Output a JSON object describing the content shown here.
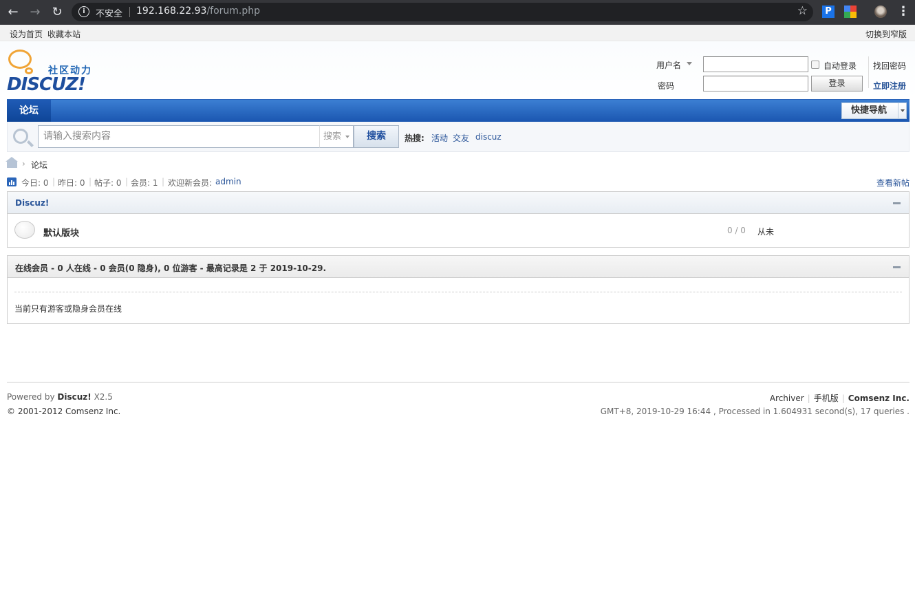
{
  "browser": {
    "security_label": "不安全",
    "url_host": "192.168.22.93",
    "url_path": "/forum.php",
    "ext_p_label": "P"
  },
  "topbar": {
    "set_homepage": "设为首页",
    "bookmark": "收藏本站",
    "switch_narrow": "切换到窄版"
  },
  "logo": {
    "tagline": "社区动力",
    "wordmark": "DISCUZ!"
  },
  "login": {
    "username_label": "用户名",
    "password_label": "密码",
    "auto_login": "自动登录",
    "login_button": "登录",
    "forgot_password": "找回密码",
    "register": "立即注册"
  },
  "nav": {
    "forum_tab": "论坛",
    "quick_nav": "快捷导航"
  },
  "search": {
    "placeholder": "请输入搜索内容",
    "scope": "搜索",
    "button": "搜索",
    "hot_label": "热搜:",
    "hot_items": [
      "活动",
      "交友",
      "discuz"
    ]
  },
  "breadcrumb": {
    "separator": "›",
    "current": "论坛"
  },
  "stats": {
    "today": "今日: 0",
    "yesterday": "昨日: 0",
    "posts": "帖子: 0",
    "members": "会员: 1",
    "welcome_label": "欢迎新会员:",
    "newest_member": "admin",
    "view_new_posts": "查看新帖"
  },
  "category": {
    "title": "Discuz!",
    "forums": [
      {
        "name": "默认版块",
        "counts": "0 / 0",
        "last_post": "从未"
      }
    ]
  },
  "online": {
    "title": "在线会员 - 0 人在线 - 0 会员(0 隐身), 0 位游客 - 最高记录是 2 于 2019-10-29.",
    "message": "当前只有游客或隐身会员在线"
  },
  "footer": {
    "powered_by": "Powered by",
    "product": "Discuz!",
    "version": "X2.5",
    "copyright": "© 2001-2012 Comsenz Inc.",
    "archiver": "Archiver",
    "mobile": "手机版",
    "company": "Comsenz Inc.",
    "stats_line": "GMT+8, 2019-10-29 16:44 , Processed in 1.604931 second(s), 17 queries ."
  }
}
